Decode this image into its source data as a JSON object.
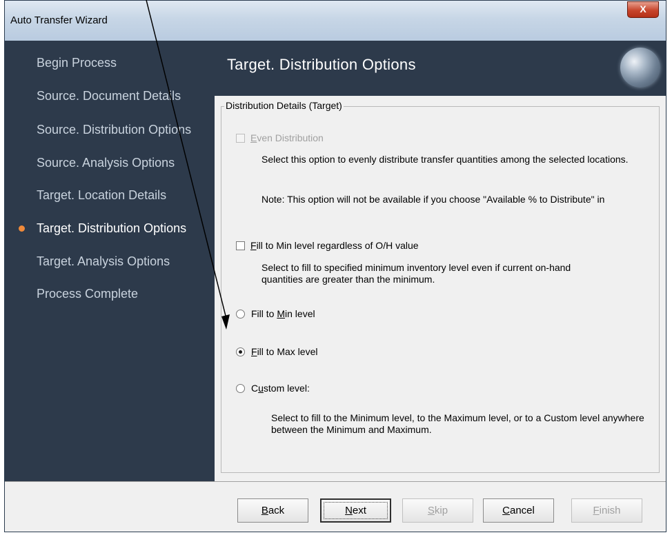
{
  "window": {
    "title": "Auto Transfer Wizard",
    "close_glyph": "X"
  },
  "sidebar": {
    "items": [
      {
        "label": "Begin Process"
      },
      {
        "label": "Source. Document Details"
      },
      {
        "label": "Source. Distribution Options"
      },
      {
        "label": "Source. Analysis Options"
      },
      {
        "label": "Target. Location Details"
      },
      {
        "label": "Target. Distribution Options",
        "active": true
      },
      {
        "label": "Target. Analysis Options"
      },
      {
        "label": "Process Complete"
      }
    ]
  },
  "header": {
    "title": "Target. Distribution Options"
  },
  "group": {
    "title": "Distribution Details (Target)"
  },
  "options": {
    "even_distribution": {
      "label_hot": "E",
      "label_rest": "ven Distribution",
      "desc": "Select this option to evenly distribute transfer quantities among the selected locations.",
      "note": "Note: This option will not be available if you choose \"Available % to Distribute\" in"
    },
    "fill_min_regardless": {
      "label_hot": "F",
      "label_rest": "ill to Min level regardless of O/H value",
      "desc": "Select to fill to specified minimum inventory level even if current on-hand quantities are greater than the minimum."
    },
    "fill_to_min": {
      "label_pre": "Fill to ",
      "label_hot": "M",
      "label_rest": "in level"
    },
    "fill_to_max": {
      "label_hot": "F",
      "label_rest": "ill to Max level",
      "checked": true
    },
    "custom_level": {
      "label_pre": "C",
      "label_hot": "u",
      "label_rest": "stom level:",
      "desc": "Select to fill to the Minimum level, to the Maximum level, or to a Custom level anywhere between the Minimum and Maximum."
    }
  },
  "buttons": {
    "back": {
      "hot": "B",
      "rest": "ack"
    },
    "next": {
      "hot": "N",
      "rest": "ext"
    },
    "skip": {
      "hot": "S",
      "rest": "kip"
    },
    "cancel": {
      "hot": "C",
      "rest": "ancel"
    },
    "finish": {
      "hot": "F",
      "rest": "inish"
    }
  },
  "colors": {
    "sidebar_bg": "#2d3a4b",
    "active_bullet": "#f08a3a"
  }
}
